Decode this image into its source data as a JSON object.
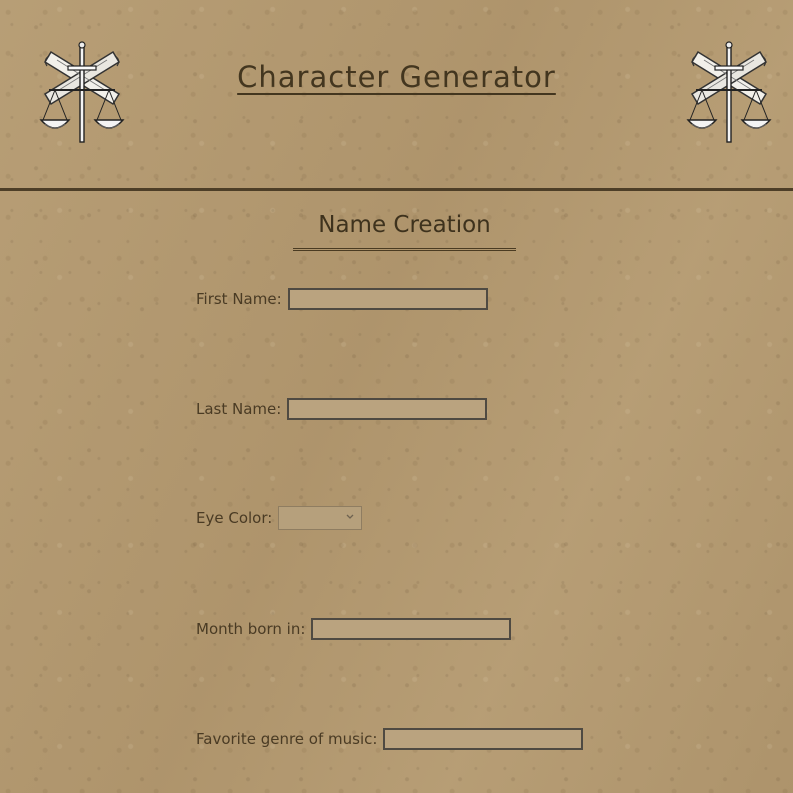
{
  "header": {
    "title": "Character Generator",
    "emblem_icon": "scales-sword-scroll-icon"
  },
  "section": {
    "title": "Name Creation"
  },
  "form": {
    "first_name": {
      "label": "First Name:",
      "value": ""
    },
    "last_name": {
      "label": "Last Name:",
      "value": ""
    },
    "eye_color": {
      "label": "Eye Color:",
      "selected": ""
    },
    "month_born": {
      "label": "Month born in:",
      "value": ""
    },
    "favorite_genre": {
      "label": "Favorite genre of music:",
      "value": ""
    }
  },
  "colors": {
    "background": "#b39970",
    "text": "#3b2f1d",
    "field_fill": "#baa37f",
    "field_border": "#4f4a42",
    "rule": "#4d3e27"
  }
}
